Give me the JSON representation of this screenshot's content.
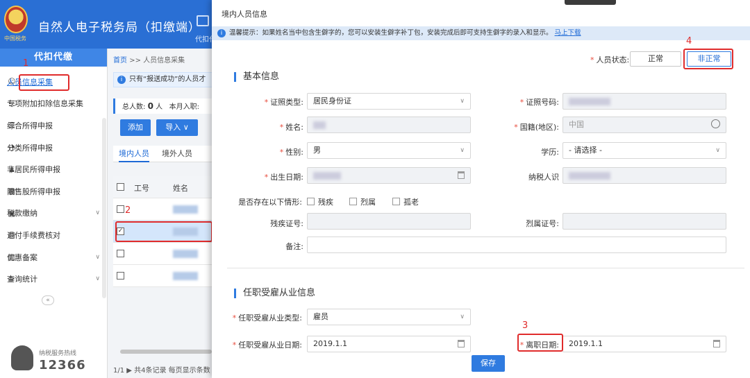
{
  "header": {
    "logo_text": "中国税务",
    "app_title": "自然人电子税务局（扣缴端）",
    "tool_label": "代扣代"
  },
  "sidebar": {
    "title": "代扣代缴",
    "items": [
      {
        "label": "人员信息采集",
        "icon": "user-icon"
      },
      {
        "label": "专项附加扣除信息采集",
        "icon": "list-icon"
      },
      {
        "label": "综合所得申报",
        "icon": "layers-icon"
      },
      {
        "label": "分类所得申报",
        "icon": "pie-icon"
      },
      {
        "label": "非居民所得申报",
        "icon": "person-icon"
      },
      {
        "label": "限售股所得申报",
        "icon": "bar-chart-icon"
      },
      {
        "label": "税款缴纳",
        "icon": "folder-icon"
      },
      {
        "label": "退付手续费核对",
        "icon": "document-icon"
      },
      {
        "label": "优惠备案",
        "icon": "file-icon"
      },
      {
        "label": "查询统计",
        "icon": "search-list-icon"
      }
    ],
    "collapse_glyph": "«",
    "hotline_label": "纳税服务热线",
    "hotline_number": "12366"
  },
  "main": {
    "breadcrumb_home": "首页",
    "breadcrumb_sep": ">>",
    "breadcrumb_page": "人员信息采集",
    "notice_text": "只有“报送成功”的人员才",
    "stats_label": "总人数:",
    "stats_count": "0",
    "stats_unit": "人",
    "stats_month": "本月入职:",
    "add_button": "添加",
    "import_button": "导入",
    "tabs": [
      "境内人员",
      "境外人员"
    ],
    "columns": [
      "工号",
      "姓名"
    ],
    "pager": "1/1 ▶ 共4条记录  每页显示条数"
  },
  "modal": {
    "title": "境内人员信息",
    "tip": "温馨提示：如果姓名当中包含生僻字的，您可以安装生僻字补丁包，安装完成后即可支持生僻字的录入和显示。",
    "tip_link": "马上下载",
    "status_label": "人员状态:",
    "status_normal": "正常",
    "status_abnormal": "非正常",
    "section_basic": "基本信息",
    "section_employment": "任职受雇从业信息",
    "fields": {
      "id_type_label": "证照类型:",
      "id_type_value": "居民身份证",
      "id_number_label": "证照号码:",
      "name_label": "姓名:",
      "nationality_label": "国籍(地区):",
      "nationality_value": "中国",
      "gender_label": "性别:",
      "gender_value": "男",
      "education_label": "学历:",
      "education_value": "- 请选择 -",
      "birth_label": "出生日期:",
      "taxpayer_label": "纳税人识",
      "situation_label": "是否存在以下情形:",
      "situations": [
        "残疾",
        "烈属",
        "孤老"
      ],
      "disability_label": "残疾证号:",
      "martyr_label": "烈属证号:",
      "remark_label": "备注:",
      "emp_type_label": "任职受雇从业类型:",
      "emp_type_value": "雇员",
      "emp_date_label": "任职受雇从业日期:",
      "emp_date_value": "2019.1.1",
      "leave_date_label": "离职日期:",
      "leave_date_value": "2019.1.1"
    },
    "save_button": "保存"
  },
  "annotations": [
    "1",
    "2",
    "3",
    "4"
  ],
  "colors": {
    "header": "#2a6fd4",
    "accent": "#2f7be0",
    "highlight": "#e02b2b"
  }
}
